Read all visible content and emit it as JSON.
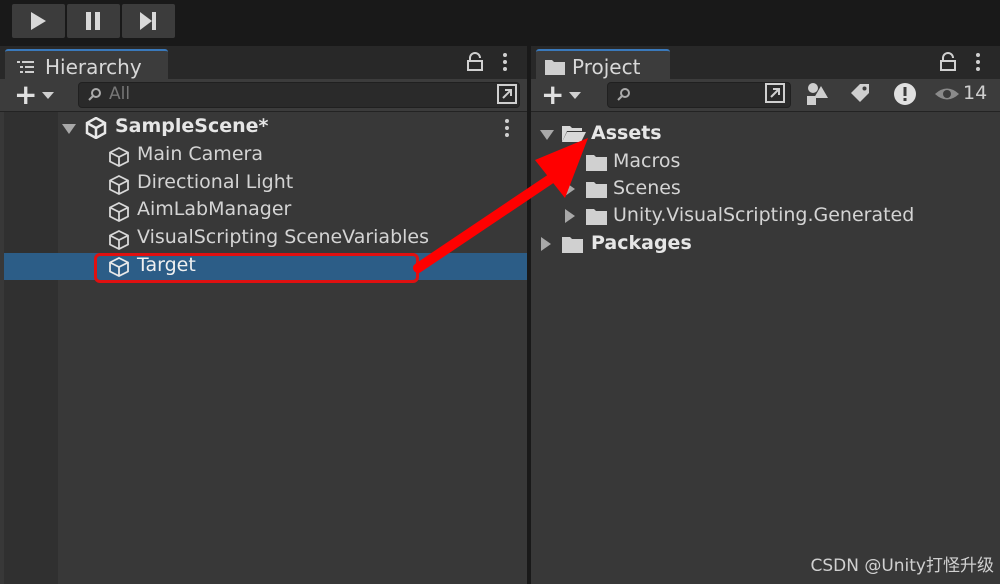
{
  "playbar": {
    "play_icon": "play-icon",
    "pause_icon": "pause-icon",
    "step_icon": "step-icon"
  },
  "hierarchy": {
    "tab_label": "Hierarchy",
    "tab_icon": "list-icon",
    "search_placeholder": "All",
    "scene": {
      "name": "SampleScene*",
      "icon": "unity-logo-icon"
    },
    "items": [
      {
        "label": "Main Camera",
        "icon": "cube-icon"
      },
      {
        "label": "Directional Light",
        "icon": "cube-icon"
      },
      {
        "label": "AimLabManager",
        "icon": "cube-icon"
      },
      {
        "label": "VisualScripting SceneVariables",
        "icon": "cube-icon"
      },
      {
        "label": "Target",
        "icon": "cube-icon",
        "selected": true
      }
    ]
  },
  "project": {
    "tab_label": "Project",
    "tab_icon": "folder-icon",
    "hidden_count": "14",
    "tree": [
      {
        "label": "Assets",
        "bold": true,
        "expanded": true
      },
      {
        "label": "Macros"
      },
      {
        "label": "Scenes"
      },
      {
        "label": "Unity.VisualScripting.Generated"
      },
      {
        "label": "Packages",
        "bold": true
      }
    ]
  },
  "annotation": {
    "highlight_color": "#e01010",
    "arrow_color": "#ff0000"
  },
  "colors": {
    "selection": "#2c5d87",
    "tab_accent": "#3a79bb"
  },
  "watermark": "CSDN @Unity打怪升级"
}
